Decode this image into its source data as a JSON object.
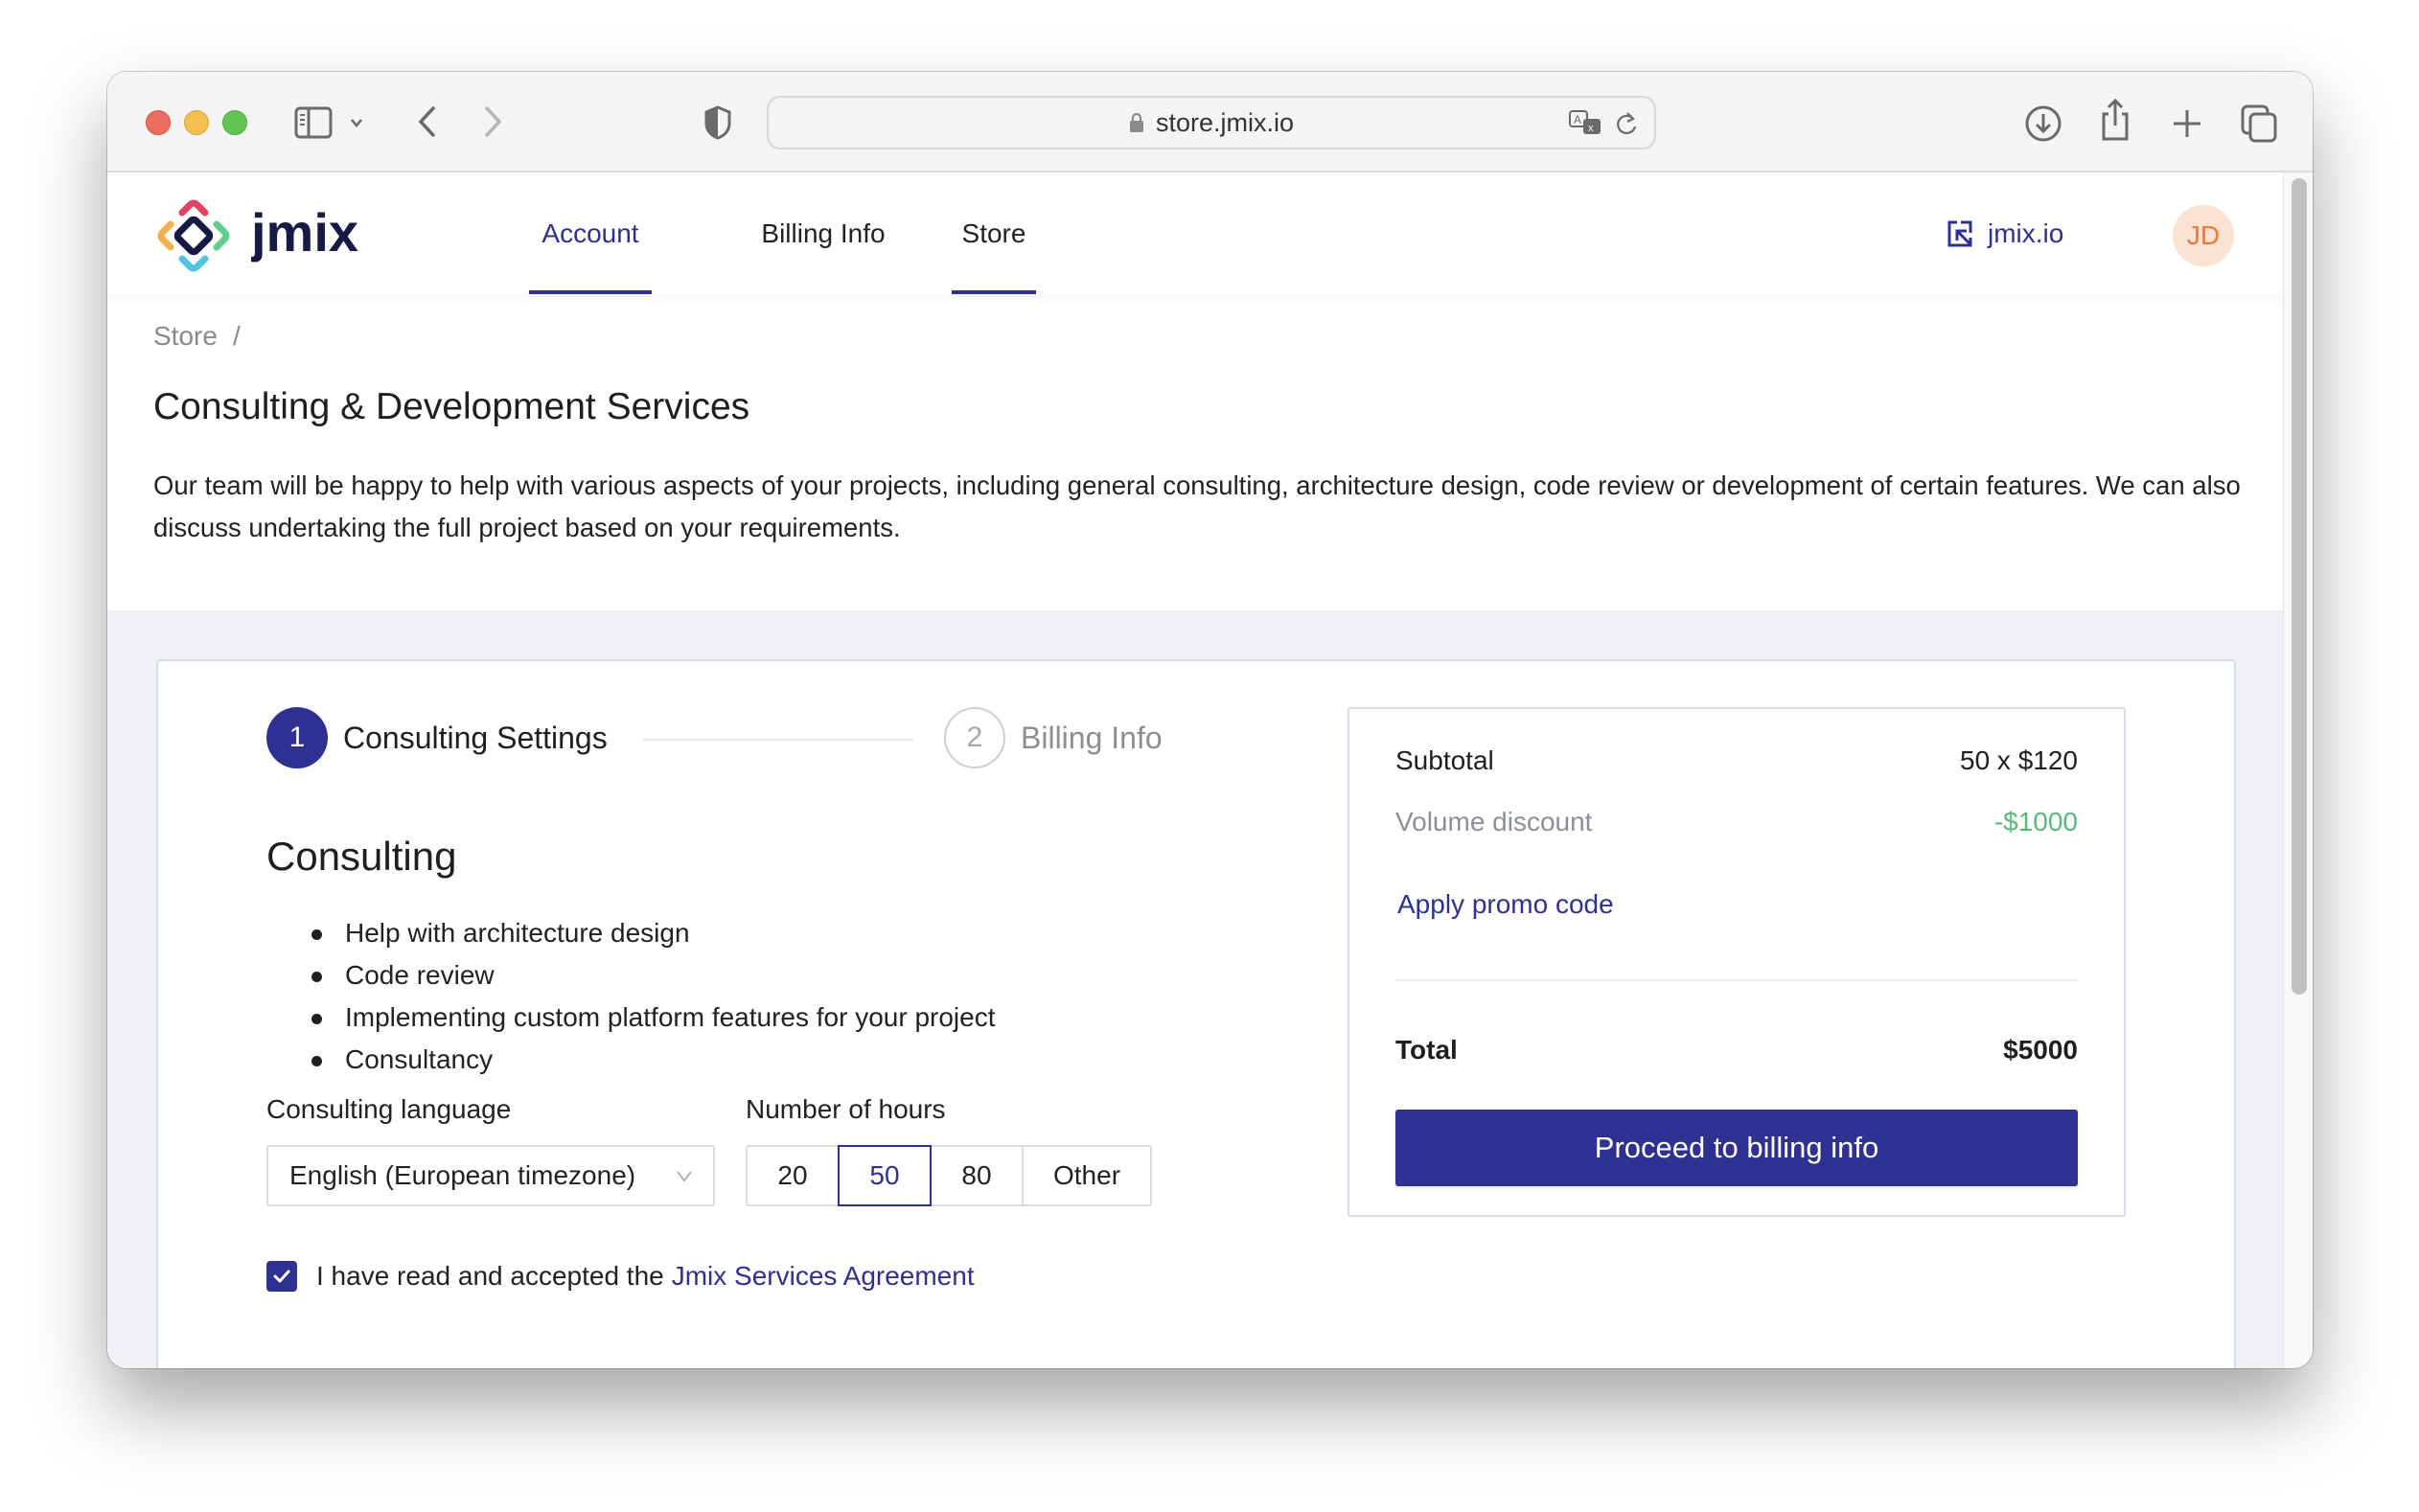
{
  "browser": {
    "url": "store.jmix.io",
    "icons": {
      "sidebar": "sidebar-icon",
      "back": "chevron-left-icon",
      "forward": "chevron-right-icon",
      "privacy": "shield-icon",
      "lock": "lock-icon",
      "translate": "translate-icon",
      "reload": "reload-icon",
      "download": "download-icon",
      "share": "share-icon",
      "new_tab": "plus-icon",
      "tab_overview": "tabs-icon"
    }
  },
  "header": {
    "brand": "jmix",
    "nav": [
      {
        "label": "Account",
        "active": true
      },
      {
        "label": "Billing Info",
        "active": false
      },
      {
        "label": "Store",
        "active": false
      }
    ],
    "external_link": "jmix.io",
    "avatar_initials": "JD"
  },
  "breadcrumb": {
    "items": [
      "Store"
    ],
    "separator": "/"
  },
  "page": {
    "title": "Consulting & Development Services",
    "description": "Our team will be happy to help with various aspects of your projects, including general consulting, architecture design, code review or development of certain features. We can also discuss undertaking the full project based on your requirements."
  },
  "stepper": {
    "steps": [
      {
        "number": "1",
        "label": "Consulting Settings",
        "state": "active"
      },
      {
        "number": "2",
        "label": "Billing Info",
        "state": "pending"
      }
    ]
  },
  "consulting": {
    "title": "Consulting",
    "features": [
      "Help with architecture design",
      "Code review",
      "Implementing custom platform features for your project",
      "Consultancy"
    ],
    "language_label": "Consulting language",
    "language_value": "English (European timezone)",
    "hours_label": "Number of hours",
    "hours_options": [
      "20",
      "50",
      "80",
      "Other"
    ],
    "hours_selected": "50",
    "agreement_checked": true,
    "agreement_text": "I have read and accepted the",
    "agreement_link": "Jmix Services Agreement"
  },
  "summary": {
    "subtotal_label": "Subtotal",
    "subtotal_value": "50 x $120",
    "discount_label": "Volume discount",
    "discount_value": "-$1000",
    "promo_link": "Apply promo code",
    "total_label": "Total",
    "total_value": "$5000",
    "proceed_button": "Proceed to billing info"
  },
  "colors": {
    "accent": "#2E3192",
    "discount_green": "#5CB87A",
    "avatar_bg": "#FAE3D2",
    "avatar_text": "#EA7A35",
    "page_bg": "#F0F1F5"
  }
}
